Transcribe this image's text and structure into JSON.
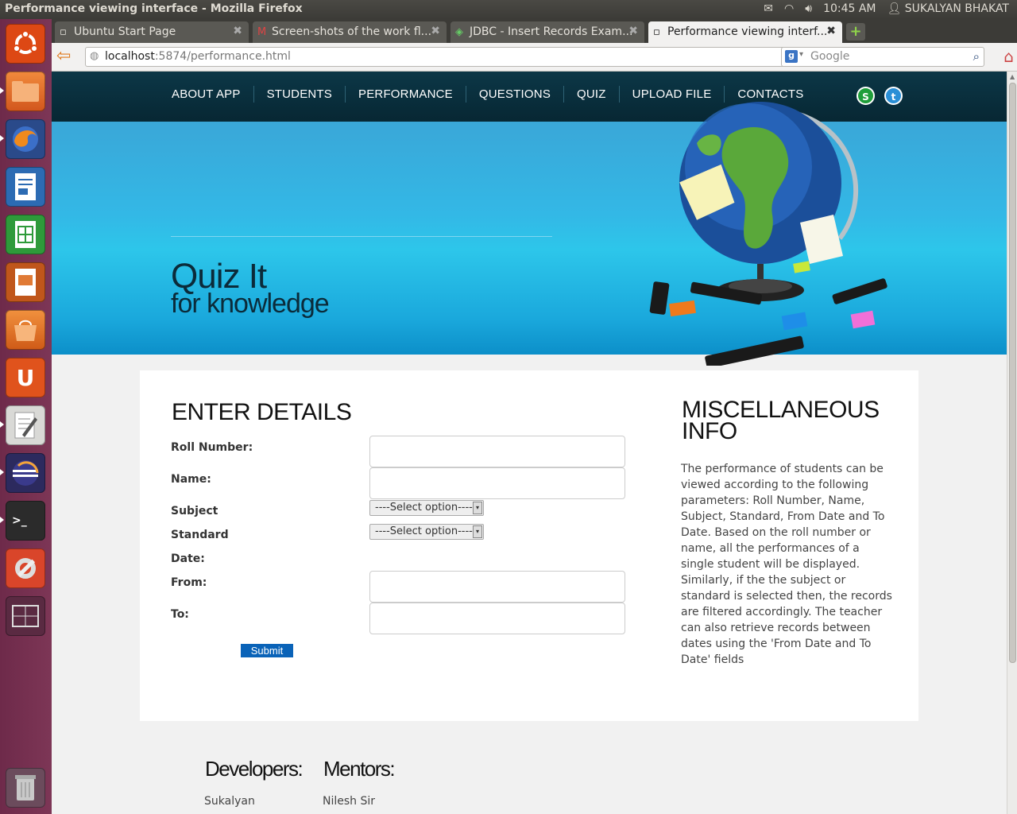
{
  "window": {
    "title": "Performance viewing interface - Mozilla Firefox",
    "clock": "10:45 AM",
    "user": "SUKALYAN BHAKAT"
  },
  "tabs": [
    {
      "label": "Ubuntu Start Page",
      "icon": "page-icon"
    },
    {
      "label": "Screen-shots of the work fl...",
      "icon": "gmail-icon"
    },
    {
      "label": "JDBC - Insert Records Exam...",
      "icon": "jdbc-icon"
    },
    {
      "label": "Performance viewing interf...",
      "icon": "page-icon"
    }
  ],
  "urlbar": {
    "host": "localhost",
    "rest": ":5874/performance.html"
  },
  "search": {
    "placeholder": "Google"
  },
  "site": {
    "menu": [
      "ABOUT APP",
      "STUDENTS",
      "PERFORMANCE",
      "QUESTIONS",
      "QUIZ",
      "UPLOAD FILE",
      "CONTACTS"
    ],
    "banner_line1": "Quiz It",
    "banner_line2": "for knowledge"
  },
  "form": {
    "heading": "ENTER DETAILS",
    "roll_label": "Roll Number:",
    "name_label": "Name:",
    "subject_label": "Subject",
    "standard_label": "Standard",
    "date_label": "Date:",
    "from_label": "From:",
    "to_label": "To:",
    "subject_select": "----Select option----",
    "standard_select": "----Select option----",
    "submit": "Submit"
  },
  "misc": {
    "heading": "MISCELLANEOUS INFO",
    "text": "The performance of students can be viewed according to the following parameters: Roll Number, Name, Subject, Standard, From Date and To Date. Based on the roll number or name, all the performances of a single student will be displayed. Similarly, if the the subject or standard is selected then, the records are filtered accordingly. The teacher can also retrieve records between dates using the 'From Date and To Date' fields"
  },
  "footer": {
    "developers_heading": "Developers:",
    "developers_name": "Sukalyan",
    "mentors_heading": "Mentors:",
    "mentors_name": "Nilesh Sir"
  }
}
